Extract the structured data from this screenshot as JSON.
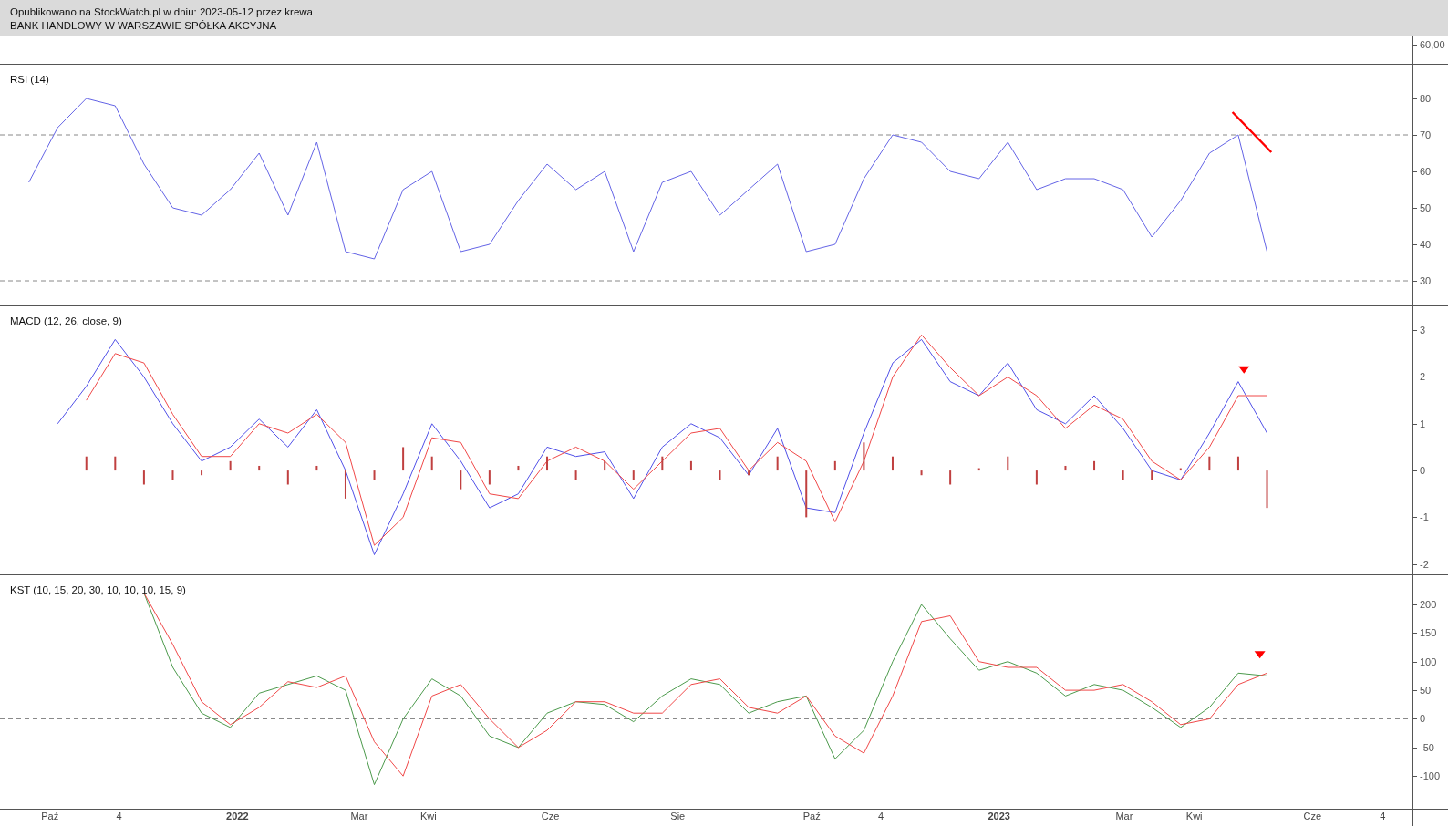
{
  "header": {
    "published": "Opublikowano na StockWatch.pl w dniu: 2023-05-12 przez krewa",
    "instrument": "BANK HANDLOWY W WARSZAWIE SPÓŁKA AKCYJNA"
  },
  "price_panel": {
    "axis_label": "60,00"
  },
  "panels": [
    {
      "title": "RSI (14)",
      "chart_data": {
        "type": "line",
        "categories": [
          null,
          null,
          null,
          null,
          null,
          null,
          null,
          null,
          null,
          null,
          null,
          null,
          null,
          null,
          null,
          null,
          null,
          null,
          null,
          null,
          null,
          null,
          null,
          null,
          null,
          null,
          null,
          null,
          null,
          null,
          null,
          null,
          null,
          null,
          null,
          null,
          null,
          null,
          null,
          null,
          null,
          null,
          null,
          null
        ],
        "ylim": [
          23.25,
          89.25
        ],
        "yticks": [
          30,
          40,
          50,
          60,
          70,
          80
        ],
        "series": [
          {
            "color": "#6464e6",
            "values": [
              57,
              72,
              80,
              78,
              62,
              50,
              48,
              55,
              65,
              48,
              68,
              38,
              36,
              55,
              60,
              38,
              40,
              52,
              62,
              55,
              60,
              38,
              57,
              60,
              48,
              55,
              62,
              38,
              40,
              58,
              70,
              68,
              60,
              58,
              68,
              55,
              58,
              58,
              55,
              42,
              52,
              65,
              70,
              38
            ]
          }
        ]
      }
    },
    {
      "title": "MACD (12, 26, close, 9)",
      "chart_data": {
        "type": "line",
        "categories": [
          null,
          null,
          null,
          null,
          null,
          null,
          null,
          null,
          null,
          null,
          null,
          null,
          null,
          null,
          null,
          null,
          null,
          null,
          null,
          null,
          null,
          null,
          null,
          null,
          null,
          null,
          null,
          null,
          null,
          null,
          null,
          null,
          null,
          null,
          null,
          null,
          null,
          null,
          null,
          null,
          null,
          null,
          null,
          null
        ],
        "ylim": [
          -2.22,
          3.51
        ],
        "yticks": [
          -2,
          -1,
          0,
          1,
          2,
          3
        ],
        "series": [
          {
            "color": "#5050e8",
            "values": [
              null,
              1.0,
              1.8,
              2.8,
              2.0,
              1.0,
              0.2,
              0.5,
              1.1,
              0.5,
              1.3,
              0.0,
              -1.8,
              -0.5,
              1.0,
              0.2,
              -0.8,
              -0.5,
              0.5,
              0.3,
              0.4,
              -0.6,
              0.5,
              1.0,
              0.7,
              -0.1,
              0.9,
              -0.8,
              -0.9,
              0.8,
              2.3,
              2.8,
              1.9,
              1.6,
              2.3,
              1.3,
              1.0,
              1.6,
              0.9,
              0.0,
              -0.2,
              0.8,
              1.9,
              0.8
            ]
          },
          {
            "color": "#f04848",
            "values": [
              null,
              null,
              1.5,
              2.5,
              2.3,
              1.2,
              0.3,
              0.3,
              1.0,
              0.8,
              1.2,
              0.6,
              -1.6,
              -1.0,
              0.7,
              0.6,
              -0.5,
              -0.6,
              0.2,
              0.5,
              0.2,
              -0.4,
              0.2,
              0.8,
              0.9,
              0.0,
              0.6,
              0.2,
              -1.1,
              0.2,
              2.0,
              2.9,
              2.2,
              1.6,
              2.0,
              1.6,
              0.9,
              1.4,
              1.1,
              0.2,
              -0.2,
              0.5,
              1.6,
              1.6
            ]
          }
        ]
      }
    },
    {
      "title": "KST (10, 15, 20, 30, 10, 10, 10, 15, 9)",
      "chart_data": {
        "type": "line",
        "categories": [
          null,
          null,
          null,
          null,
          null,
          null,
          null,
          null,
          null,
          null,
          null,
          null,
          null,
          null,
          null,
          null,
          null,
          null,
          null,
          null,
          null,
          null,
          null,
          null,
          null,
          null,
          null,
          null,
          null,
          null,
          null,
          null,
          null,
          null,
          null,
          null,
          null,
          null,
          null,
          null,
          null,
          null,
          null,
          null
        ],
        "ylim": [
          -157,
          251
        ],
        "yticks": [
          -100,
          -50,
          0,
          50,
          100,
          150,
          200
        ],
        "series": [
          {
            "color": "#4c9a4c",
            "values": [
              null,
              null,
              null,
              null,
              220,
              90,
              10,
              -15,
              45,
              60,
              75,
              50,
              -115,
              0,
              70,
              40,
              -30,
              -50,
              10,
              30,
              25,
              -5,
              40,
              70,
              60,
              10,
              30,
              40,
              -70,
              -20,
              100,
              200,
              140,
              85,
              100,
              80,
              40,
              60,
              50,
              20,
              -15,
              20,
              80,
              75
            ]
          },
          {
            "color": "#f04848",
            "values": [
              null,
              null,
              null,
              null,
              220,
              130,
              30,
              -10,
              20,
              65,
              55,
              75,
              -40,
              -100,
              40,
              60,
              0,
              -50,
              -20,
              30,
              30,
              10,
              10,
              60,
              70,
              20,
              10,
              40,
              -30,
              -60,
              40,
              170,
              180,
              100,
              90,
              90,
              50,
              50,
              60,
              30,
              -10,
              0,
              60,
              80
            ]
          }
        ]
      }
    }
  ],
  "x_axis": {
    "ticks": [
      {
        "label": "Paź",
        "emphasis": false
      },
      {
        "label": "4",
        "emphasis": false
      },
      {
        "label": "2022",
        "emphasis": true
      },
      {
        "label": "Mar",
        "emphasis": false
      },
      {
        "label": "Kwi",
        "emphasis": false
      },
      {
        "label": "Cze",
        "emphasis": false
      },
      {
        "label": "Sie",
        "emphasis": false
      },
      {
        "label": "Paź",
        "emphasis": false
      },
      {
        "label": "4",
        "emphasis": false
      },
      {
        "label": "2023",
        "emphasis": true
      },
      {
        "label": "Mar",
        "emphasis": false
      },
      {
        "label": "Kwi",
        "emphasis": false
      },
      {
        "label": "Cze",
        "emphasis": false
      },
      {
        "label": "4",
        "emphasis": false
      }
    ]
  }
}
